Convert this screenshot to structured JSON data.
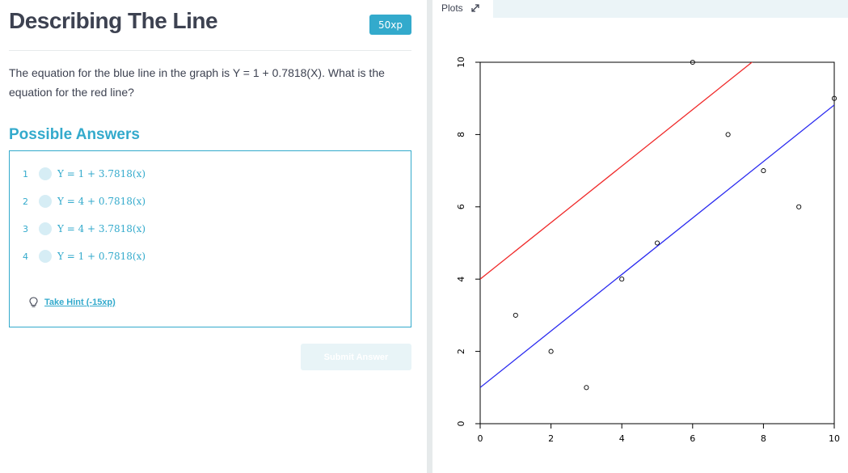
{
  "exercise": {
    "title": "Describing The Line",
    "xp_badge": "50xp",
    "question": "The equation for the blue line in the graph is Y = 1 + 0.7818(X). What is the equation for the red line?",
    "answers_heading": "Possible Answers",
    "answers": [
      {
        "number": "1",
        "text": "Y = 1 + 3.7818(x)"
      },
      {
        "number": "2",
        "text": "Y = 4 + 0.7818(x)"
      },
      {
        "number": "3",
        "text": "Y = 4 + 3.7818(x)"
      },
      {
        "number": "4",
        "text": "Y = 1 + 0.7818(x)"
      }
    ],
    "hint_label": "Take Hint (-15xp)",
    "submit_label": "Submit Answer"
  },
  "plots_panel": {
    "tab_label": "Plots",
    "expand_icon": "expand-arrow-icon"
  },
  "colors": {
    "accent": "#33aacc",
    "title_text": "#3d4251",
    "blue_line": "#2a2af0",
    "red_line": "#f02a2a"
  },
  "chart_data": {
    "type": "scatter",
    "title": "",
    "xlabel": "",
    "ylabel": "",
    "xlim": [
      0,
      10
    ],
    "ylim": [
      0,
      10
    ],
    "x_ticks": [
      "0",
      "2",
      "4",
      "6",
      "8",
      "10"
    ],
    "y_ticks": [
      "0",
      "2",
      "4",
      "6",
      "8",
      "10"
    ],
    "grid": false,
    "points": [
      {
        "x": 1,
        "y": 3
      },
      {
        "x": 2,
        "y": 2
      },
      {
        "x": 3,
        "y": 1
      },
      {
        "x": 4,
        "y": 4
      },
      {
        "x": 5,
        "y": 5
      },
      {
        "x": 6,
        "y": 10
      },
      {
        "x": 7,
        "y": 8
      },
      {
        "x": 8,
        "y": 7
      },
      {
        "x": 9,
        "y": 6
      },
      {
        "x": 10,
        "y": 9
      }
    ],
    "lines": [
      {
        "color": "#f02a2a",
        "intercept": 4,
        "slope": 0.7818
      },
      {
        "color": "#2a2af0",
        "intercept": 1,
        "slope": 0.7818
      }
    ]
  }
}
